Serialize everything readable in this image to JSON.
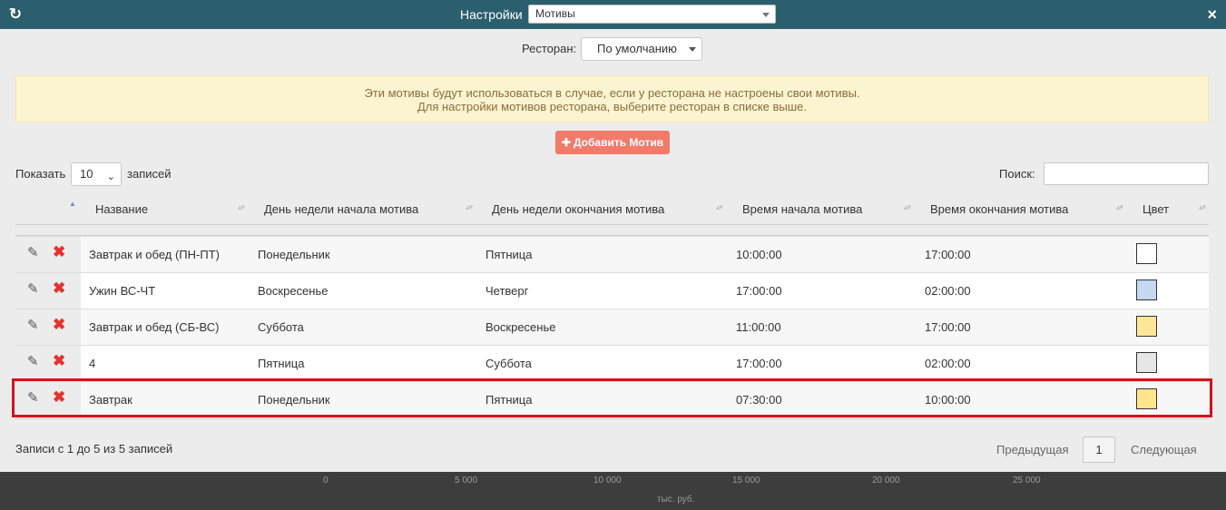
{
  "window": {
    "title": "Настройки",
    "selected_section": "Мотивы",
    "close_glyph": "×",
    "refresh_icon": "refresh-icon"
  },
  "restaurant": {
    "label": "Ресторан:",
    "value": "По умолчанию"
  },
  "alert": {
    "line1": "Эти мотивы будут использоваться в случае, если у ресторана не настроены свои мотивы.",
    "line2": "Для настройки мотивов ресторана, выберите ресторан в списке выше."
  },
  "add_button": {
    "label": "Добавить Мотив"
  },
  "length": {
    "prefix": "Показать",
    "value": "10",
    "suffix": "записей"
  },
  "search": {
    "label": "Поиск:",
    "value": ""
  },
  "columns": [
    "Название",
    "День недели начала мотива",
    "День недели окончания мотива",
    "Время начала мотива",
    "Время окончания мотива",
    "Цвет"
  ],
  "rows": [
    {
      "name": "Завтрак и обед (ПН-ПТ)",
      "start_day": "Понедельник",
      "end_day": "Пятница",
      "start_time": "10:00:00",
      "end_time": "17:00:00",
      "color": "#ffffff"
    },
    {
      "name": "Ужин ВС-ЧТ",
      "start_day": "Воскресенье",
      "end_day": "Четверг",
      "start_time": "17:00:00",
      "end_time": "02:00:00",
      "color": "#c5d9f1"
    },
    {
      "name": "Завтрак и обед (СБ-ВС)",
      "start_day": "Суббота",
      "end_day": "Воскресенье",
      "start_time": "11:00:00",
      "end_time": "17:00:00",
      "color": "#ffe699"
    },
    {
      "name": "4",
      "start_day": "Пятница",
      "end_day": "Суббота",
      "start_time": "17:00:00",
      "end_time": "02:00:00",
      "color": "#e7e6e6"
    },
    {
      "name": "Завтрак",
      "start_day": "Понедельник",
      "end_day": "Пятница",
      "start_time": "07:30:00",
      "end_time": "10:00:00",
      "color": "#ffe48a"
    }
  ],
  "footer": {
    "info": "Записи с 1 до 5 из 5 записей",
    "prev": "Предыдущая",
    "page": "1",
    "next": "Следующая"
  },
  "backdrop_chart": {
    "ticks": [
      "0",
      "5 000",
      "10 000",
      "15 000",
      "20 000",
      "25 000"
    ],
    "unit": "тыс. руб."
  },
  "colors": {
    "titlebar": "#2b5f6e",
    "add_button": "#f27a6b",
    "highlight": "#d4121b",
    "delete": "#e4322c"
  }
}
